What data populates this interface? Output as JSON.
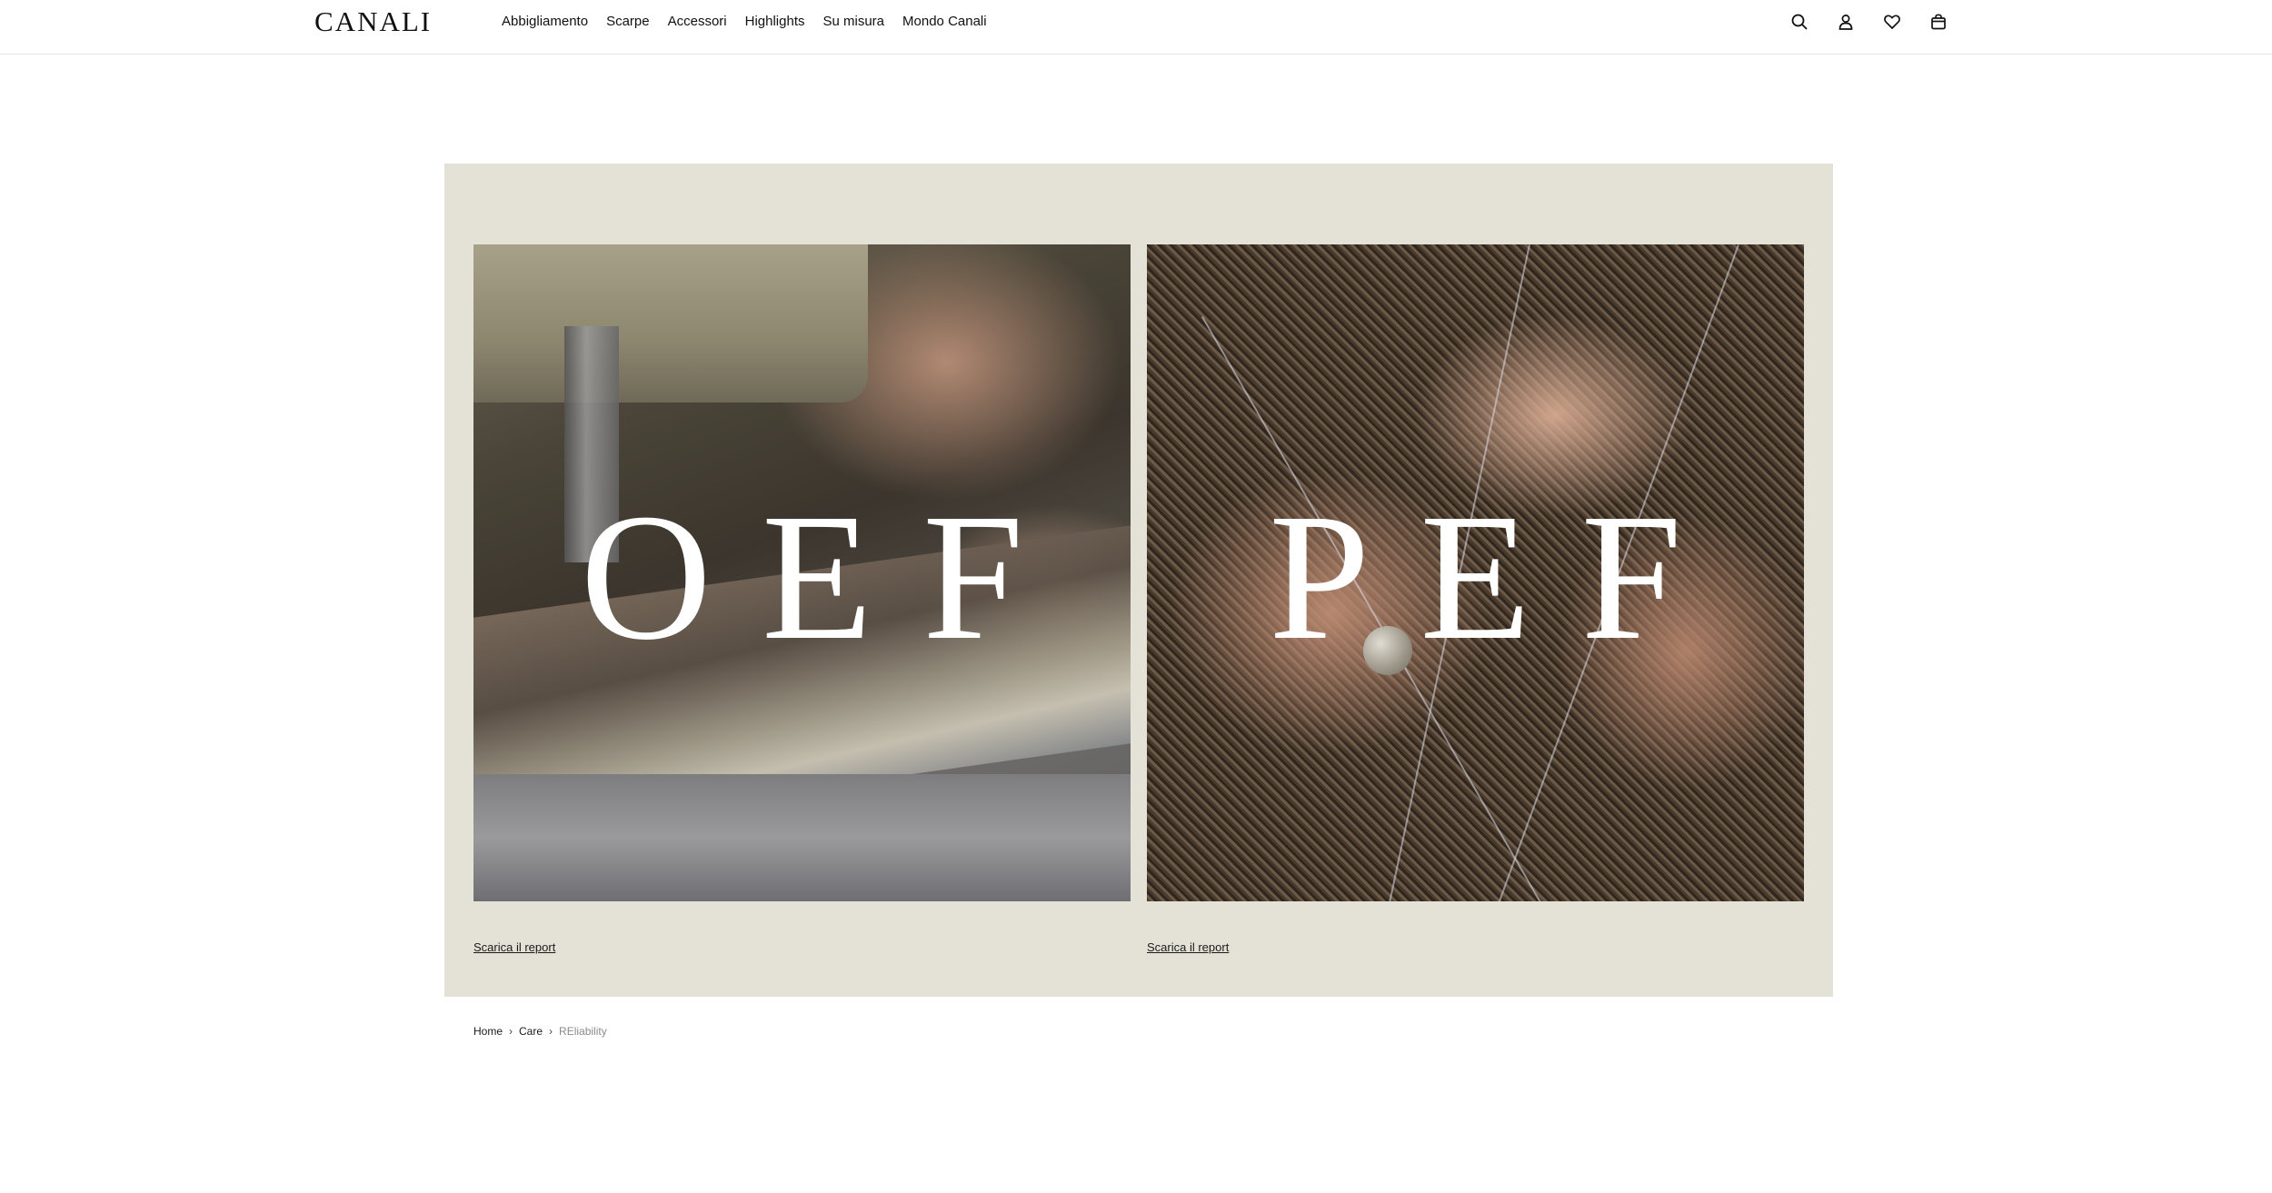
{
  "header": {
    "logo": "CANALI",
    "nav": [
      "Abbigliamento",
      "Scarpe",
      "Accessori",
      "Highlights",
      "Su misura",
      "Mondo Canali"
    ],
    "icons": [
      "search-icon",
      "account-icon",
      "wishlist-icon",
      "bag-icon"
    ]
  },
  "main": {
    "panel_color": "#e4e2d7",
    "cards": [
      {
        "title": "OEF",
        "link": "Scarica il report"
      },
      {
        "title": "PEF",
        "link": "Scarica il report"
      }
    ]
  },
  "breadcrumb": {
    "items": [
      "Home",
      "Care",
      "REliability"
    ],
    "separator": "›"
  }
}
